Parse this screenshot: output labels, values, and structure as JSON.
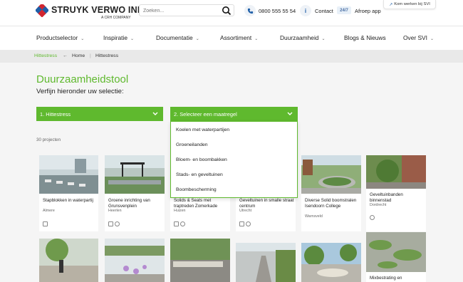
{
  "brand": {
    "name": "STRUYK VERWO INFRA",
    "sub": "A CRH COMPANY"
  },
  "search": {
    "placeholder": "Zoeken..."
  },
  "header": {
    "phone": "0800 555 55 54",
    "contact": "Contact",
    "badge": "24/7",
    "afroep": "Afroep app",
    "werken": "Kom werken bij SVI"
  },
  "nav": [
    {
      "label": "Productselector"
    },
    {
      "label": "Inspiratie"
    },
    {
      "label": "Documentatie"
    },
    {
      "label": "Assortiment"
    },
    {
      "label": "Duurzaamheid"
    },
    {
      "label": "Blogs & Nieuws"
    },
    {
      "label": "Over SVI"
    }
  ],
  "breadcrumb": {
    "current": "Hittestress",
    "home": "Home",
    "page": "Hittestress"
  },
  "main": {
    "title": "Duurzaamheidstool",
    "subtitle": "Verfijn hieronder uw selectie:",
    "count": "30 projecten"
  },
  "filters": {
    "first": "1. Hittestress",
    "second": "2. Selecteer een maatregel"
  },
  "dropdown": [
    "Koelen met waterpartijen",
    "Groeneilanden",
    "Bloem- en boombakken",
    "Stads- en geveltuinen",
    "Boombescherming"
  ],
  "cards": [
    {
      "title": "Stapblokken in waterpartij",
      "loc": "Almere"
    },
    {
      "title": "Groene inrichting van Grunsvenplein",
      "loc": "Heerlen"
    },
    {
      "title": "Solids & Seats met traptreden Zomerkade",
      "loc": "Huizen"
    },
    {
      "title": "Geveltuinen in smalle straat centrum",
      "loc": "Utrecht"
    },
    {
      "title": "Diverse Solid boomstralen Isendoorn College",
      "loc": "Warnsveld"
    },
    {
      "title": "Geveltuinbanden binnenstad",
      "loc": "Dordrecht"
    },
    {
      "title": "Mixbestrating en",
      "loc": ""
    }
  ],
  "colors": {
    "accent": "#5fb92e",
    "logo_red": "#d22630",
    "logo_blue": "#1f5fa8"
  },
  "icons": [
    "search-icon",
    "phone-icon",
    "info-icon",
    "chevron-down-icon",
    "arrow-left-icon"
  ]
}
